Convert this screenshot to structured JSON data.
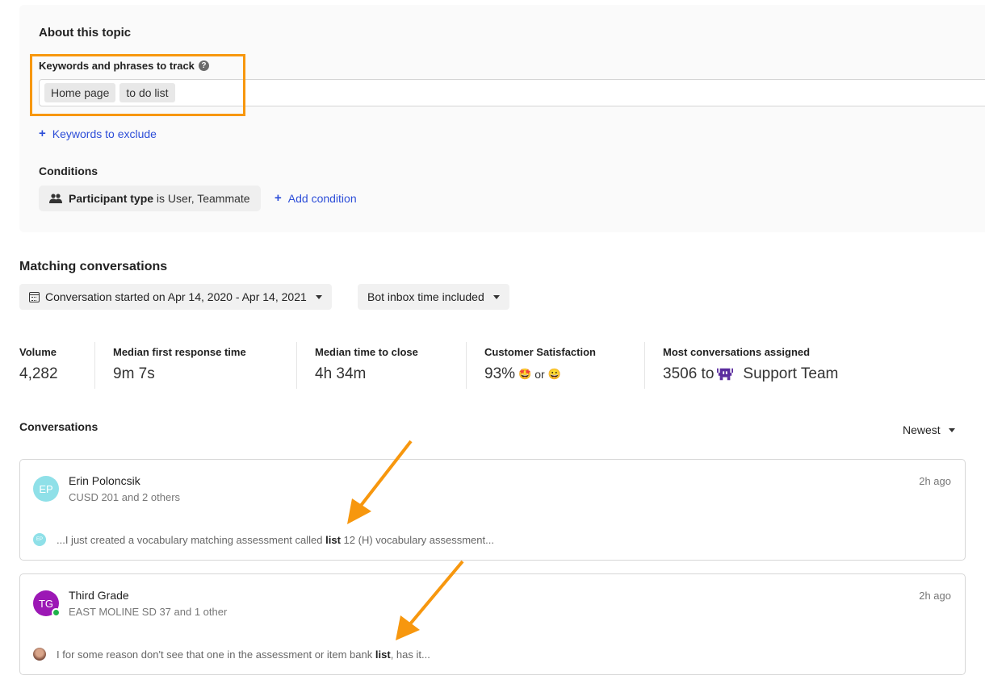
{
  "about": {
    "title": "About this topic",
    "keywords_label": "Keywords and phrases to track",
    "keywords": [
      "Home page",
      "to do list"
    ],
    "exclude_link": "Keywords to exclude",
    "conditions_label": "Conditions",
    "condition": {
      "field": "Participant type",
      "text": "is User, Teammate"
    },
    "add_condition": "Add condition"
  },
  "matching": {
    "title": "Matching conversations",
    "date_filter": "Conversation started on Apr 14, 2020 - Apr 14, 2021",
    "bot_filter": "Bot inbox time included"
  },
  "stats": [
    {
      "label": "Volume",
      "value": "4,282"
    },
    {
      "label": "Median first response time",
      "value": "9m 7s"
    },
    {
      "label": "Median time to close",
      "value": "4h 34m"
    },
    {
      "label": "Customer Satisfaction",
      "value": "93%",
      "emoji_a": "🤩",
      "or": "or",
      "emoji_b": "😀"
    },
    {
      "label": "Most conversations assigned",
      "value": "3506 to",
      "team": "Support Team"
    }
  ],
  "conversations": {
    "title": "Conversations",
    "sort": "Newest",
    "items": [
      {
        "initials": "EP",
        "avatar_color": "#8fe0e8",
        "name": "Erin Poloncsik",
        "sub": "CUSD 201 and 2 others",
        "time": "2h ago",
        "snippet_before": "...I just created a vocabulary matching assessment called",
        "snippet_match": "list",
        "snippet_after": "12 (H) vocabulary assessment..."
      },
      {
        "initials": "TG",
        "avatar_color": "#9c18b5",
        "name": "Third Grade",
        "sub": "EAST MOLINE SD 37 and 1 other",
        "time": "2h ago",
        "snippet_before": "I for some reason don't see that one in the assessment or item bank",
        "snippet_match": "list",
        "snippet_after": ", has it..."
      }
    ]
  },
  "colors": {
    "accent_link": "#2d4ed8",
    "annotation": "#f7970e",
    "online": "#1fb24a"
  }
}
